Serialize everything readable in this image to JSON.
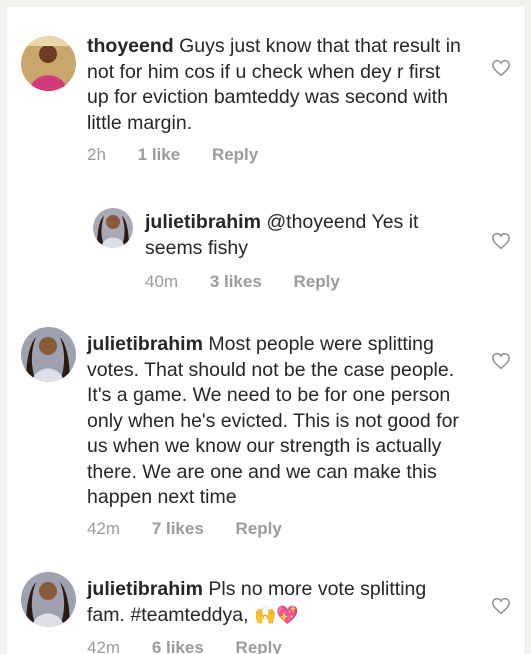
{
  "comments": [
    {
      "username": "thoyeend",
      "text": "Guys just know that that result in not for him cos if u check when dey r first up for eviction bamteddy was second with little margin.",
      "time": "2h",
      "likes": "1 like",
      "reply": "Reply"
    },
    {
      "username": "julietibrahim",
      "mention": "@thoyeend",
      "text": "Yes it seems fishy",
      "time": "40m",
      "likes": "3 likes",
      "reply": "Reply"
    },
    {
      "username": "julietibrahim",
      "text": "Most people were splitting votes. That should not be the case people. It's a game. We need to be for one person only when he's evicted. This is not good for us when we know our strength is actually there. We are one and we can make this happen next time",
      "time": "42m",
      "likes": "7 likes",
      "reply": "Reply"
    },
    {
      "username": "julietibrahim",
      "text": "Pls no more vote splitting fam.",
      "hashtag": "#teamteddya,",
      "emoji": "🙌💖",
      "time": "42m",
      "likes": "6 likes",
      "reply": "Reply"
    }
  ],
  "icons": {
    "like": "heart-outline-icon"
  },
  "colors": {
    "text": "#262626",
    "meta": "#9b9b9b",
    "heart": "#8e8e8e",
    "background": "#ffffff",
    "frame": "#f1f3ef"
  }
}
